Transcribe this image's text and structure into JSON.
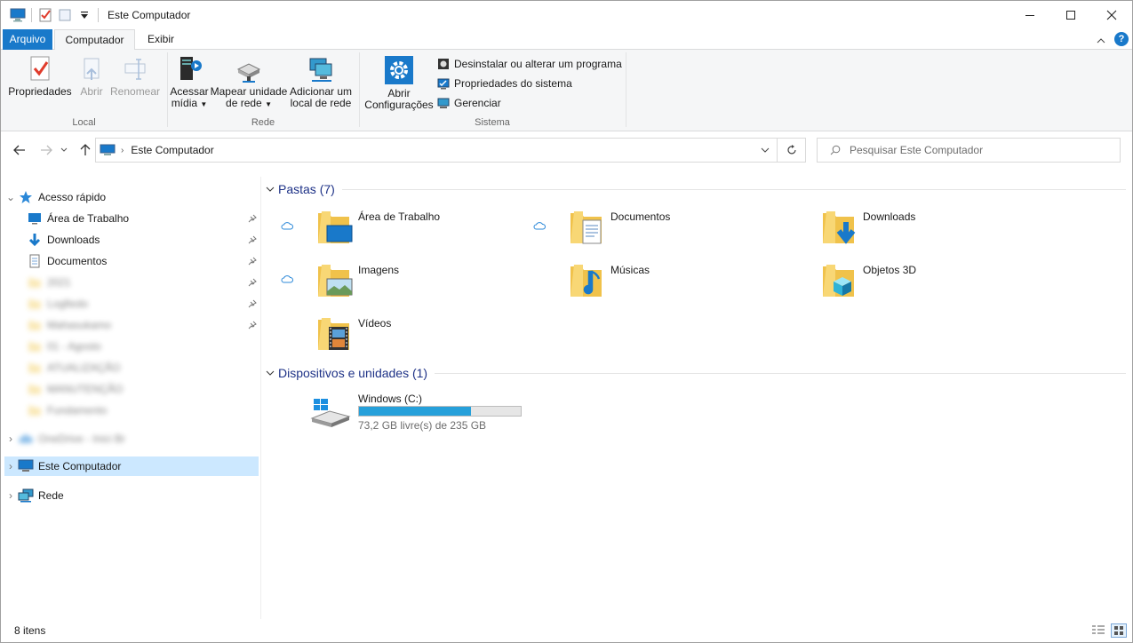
{
  "window": {
    "title": "Este Computador"
  },
  "quick_access_toolbar": {
    "icons": [
      "computer-icon",
      "properties-icon",
      "new-folder-icon",
      "customize-dropdown-icon"
    ]
  },
  "window_controls": {
    "minimize": "minimize-icon",
    "maximize": "maximize-icon",
    "close": "close-icon"
  },
  "tabs": [
    {
      "label": "Arquivo"
    },
    {
      "label": "Computador"
    },
    {
      "label": "Exibir"
    }
  ],
  "ribbon": {
    "groups": {
      "local": "Local",
      "rede": "Rede",
      "sistema": "Sistema"
    },
    "propriedades": "Propriedades",
    "abrir": "Abrir",
    "renomear": "Renomear",
    "acessar_midia": {
      "line1": "Acessar",
      "line2": "mídia"
    },
    "mapear": {
      "line1": "Mapear unidade",
      "line2": "de rede"
    },
    "adicionar_local": {
      "line1": "Adicionar um",
      "line2": "local de rede"
    },
    "abrir_config": {
      "line1": "Abrir",
      "line2": "Configurações"
    },
    "desinstalar": "Desinstalar ou alterar um programa",
    "propriedades_sistema": "Propriedades do sistema",
    "gerenciar": "Gerenciar"
  },
  "address": {
    "path": "Este Computador"
  },
  "search": {
    "placeholder": "Pesquisar Este Computador"
  },
  "nav": {
    "quick_access": "Acesso rápido",
    "pinned": [
      {
        "label": "Área de Trabalho"
      },
      {
        "label": "Downloads"
      },
      {
        "label": "Documentos"
      }
    ],
    "blurred": [
      "2021",
      "Logfiedo",
      "Mahasukamo",
      "01 - Agosto",
      "ATUALIZAÇÃO",
      "MANUTENÇÃO",
      "Fundamento"
    ],
    "blurred_cloud": "OneDrive - Inici Br",
    "this_pc": "Este Computador",
    "network": "Rede"
  },
  "folders_section": {
    "title": "Pastas (7)"
  },
  "folders": [
    {
      "name": "Área de Trabalho",
      "cloud": true
    },
    {
      "name": "Documentos",
      "cloud": true
    },
    {
      "name": "Downloads",
      "cloud": false
    },
    {
      "name": "Imagens",
      "cloud": true
    },
    {
      "name": "Músicas",
      "cloud": false
    },
    {
      "name": "Objetos 3D",
      "cloud": false
    },
    {
      "name": "Vídeos",
      "cloud": false
    }
  ],
  "devices_section": {
    "title": "Dispositivos e unidades (1)"
  },
  "drive": {
    "name": "Windows (C:)",
    "free_text": "73,2 GB livre(s) de 235 GB",
    "used_fraction": 0.69
  },
  "status": {
    "items": "8 itens"
  },
  "colors": {
    "accent": "#1979ca",
    "selection": "#cce8ff",
    "section_title": "#1e3287",
    "drive_bar": "#26a0da"
  }
}
